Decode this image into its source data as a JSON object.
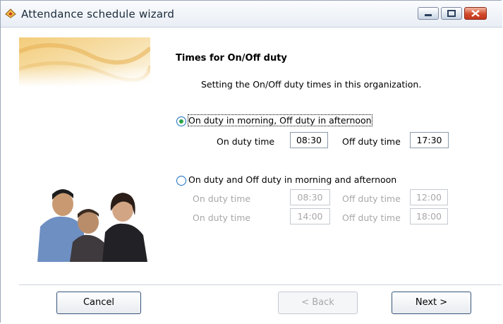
{
  "window": {
    "title": "Attendance schedule wizard"
  },
  "page": {
    "heading": "Times for On/Off duty",
    "description": "Setting the On/Off duty times in this organization."
  },
  "option1": {
    "label": "On duty in morning, Off duty in afternoon",
    "selected": true,
    "on_duty_label": "On duty time",
    "on_duty_value": "08:30",
    "off_duty_label": "Off duty time",
    "off_duty_value": "17:30"
  },
  "option2": {
    "label": "On duty and Off duty in morning and afternoon",
    "selected": false,
    "row1": {
      "on_duty_label": "On duty time",
      "on_duty_value": "08:30",
      "off_duty_label": "Off duty time",
      "off_duty_value": "12:00"
    },
    "row2": {
      "on_duty_label": "On duty time",
      "on_duty_value": "14:00",
      "off_duty_label": "Off duty time",
      "off_duty_value": "18:00"
    }
  },
  "buttons": {
    "cancel": "Cancel",
    "back": "< Back",
    "next": "Next >"
  },
  "icons": {
    "app": "wizard-hat-icon",
    "minimize": "minimize-icon",
    "maximize": "maximize-icon",
    "close": "close-icon"
  },
  "colors": {
    "selected_radio_dot": "#2aa34a",
    "close_button": "#d24a2b",
    "disabled_text": "#a8a8a8"
  }
}
